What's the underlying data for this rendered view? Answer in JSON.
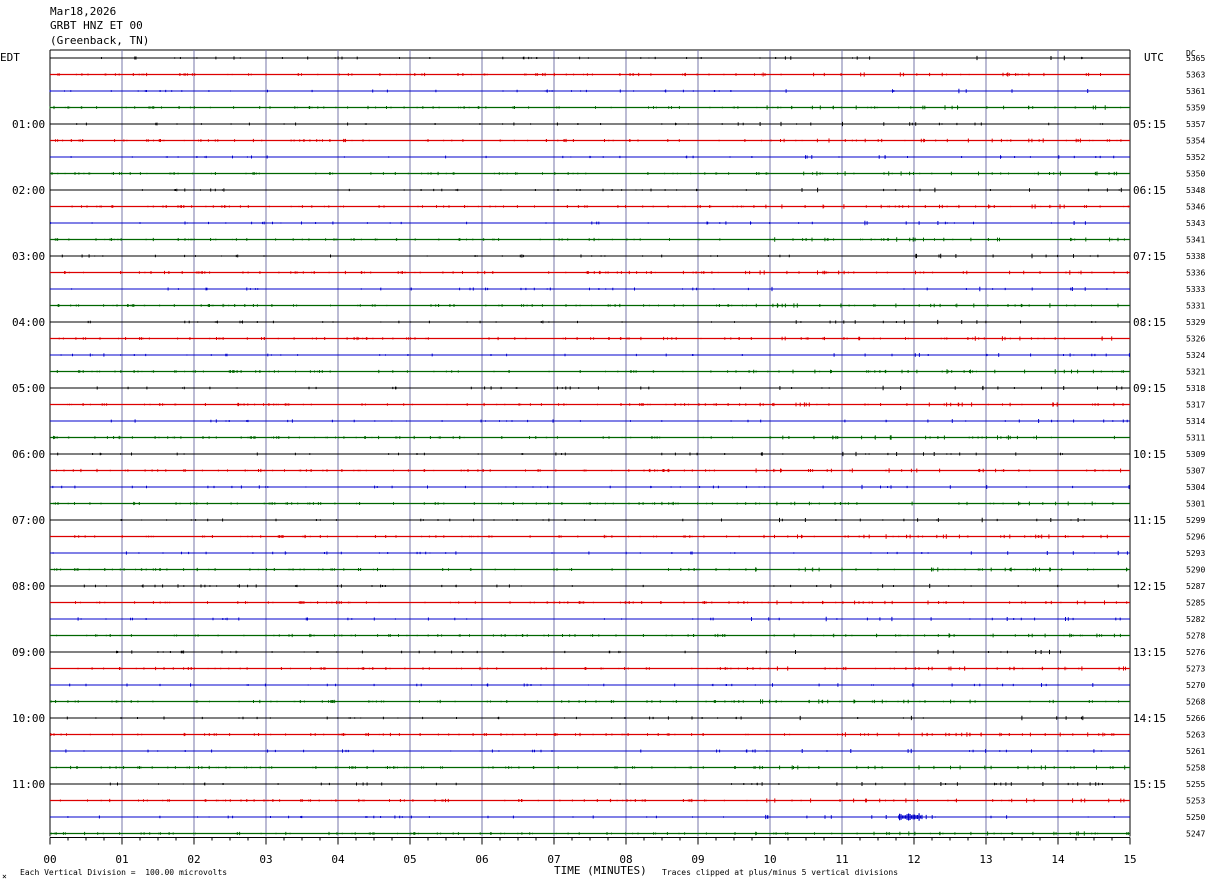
{
  "header": {
    "date": "Mar18,2026",
    "channel": "GRBT HNZ ET 00",
    "location": "(Greenback, TN)"
  },
  "footer": {
    "scale_note": "Each Vertical Division =  100.00 microvolts",
    "clip_note": "Traces clipped at plus/minus 5 vertical divisions",
    "corner_mark": "×"
  },
  "colors": {
    "trace_cycle": [
      "#000000",
      "#dd0000",
      "#0000cc",
      "#006600"
    ],
    "grid": "#7777aa"
  },
  "chart_data": {
    "type": "line",
    "title": "",
    "xlabel": "TIME (MINUTES)",
    "left_label": "EDT",
    "right_label": "UTC",
    "dc_label": "DC",
    "xlim": [
      0,
      15
    ],
    "x_ticks": [
      "00",
      "01",
      "02",
      "03",
      "04",
      "05",
      "06",
      "07",
      "08",
      "09",
      "10",
      "11",
      "12",
      "13",
      "14",
      "15"
    ],
    "left_ticks": [
      {
        "row": 4,
        "label": "01:00"
      },
      {
        "row": 8,
        "label": "02:00"
      },
      {
        "row": 12,
        "label": "03:00"
      },
      {
        "row": 16,
        "label": "04:00"
      },
      {
        "row": 20,
        "label": "05:00"
      },
      {
        "row": 24,
        "label": "06:00"
      },
      {
        "row": 28,
        "label": "07:00"
      },
      {
        "row": 32,
        "label": "08:00"
      },
      {
        "row": 36,
        "label": "09:00"
      },
      {
        "row": 40,
        "label": "10:00"
      },
      {
        "row": 44,
        "label": "11:00"
      }
    ],
    "right_ticks": [
      {
        "row": 4,
        "label": "05:15"
      },
      {
        "row": 8,
        "label": "06:15"
      },
      {
        "row": 12,
        "label": "07:15"
      },
      {
        "row": 16,
        "label": "08:15"
      },
      {
        "row": 20,
        "label": "09:15"
      },
      {
        "row": 24,
        "label": "10:15"
      },
      {
        "row": 28,
        "label": "11:15"
      },
      {
        "row": 32,
        "label": "12:15"
      },
      {
        "row": 36,
        "label": "13:15"
      },
      {
        "row": 40,
        "label": "14:15"
      },
      {
        "row": 44,
        "label": "15:15"
      }
    ],
    "dc_values": [
      "5365",
      "5363",
      "5361",
      "5359",
      "5357",
      "5354",
      "5352",
      "5350",
      "5348",
      "5346",
      "5343",
      "5341",
      "5338",
      "5336",
      "5333",
      "5331",
      "5329",
      "5326",
      "5324",
      "5321",
      "5318",
      "5317",
      "5314",
      "5311",
      "5309",
      "5307",
      "5304",
      "5301",
      "5299",
      "5296",
      "5293",
      "5290",
      "5287",
      "5285",
      "5282",
      "5278",
      "5276",
      "5273",
      "5270",
      "5268",
      "5266",
      "5263",
      "5261",
      "5258",
      "5255",
      "5253",
      "5250",
      "5247"
    ],
    "event": {
      "row": 46,
      "minute_start": 11.8,
      "minute_end": 12.1
    }
  }
}
